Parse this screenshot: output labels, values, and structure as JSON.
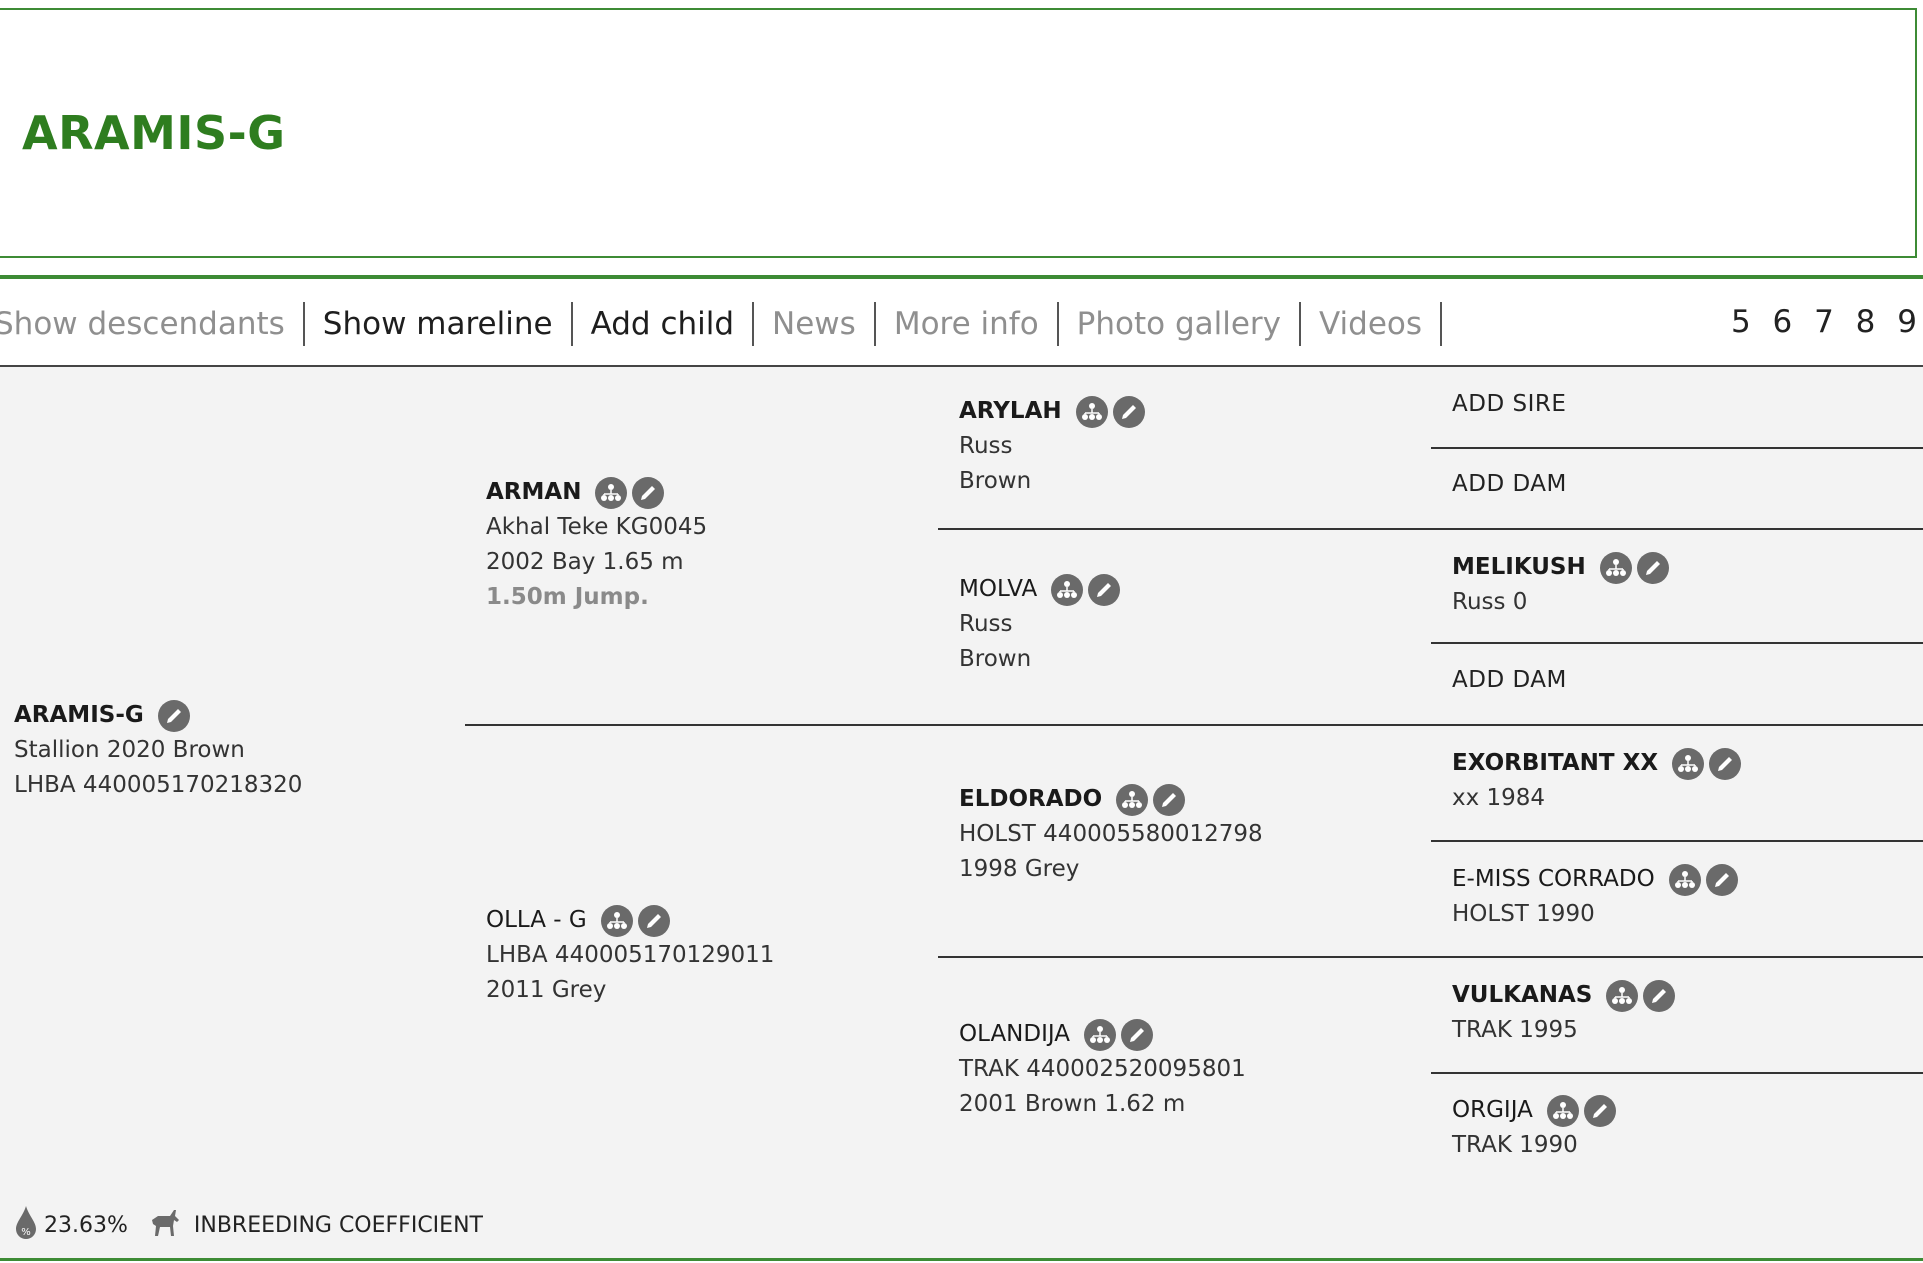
{
  "header": {
    "title": "ARAMIS-G"
  },
  "tabs": [
    {
      "label": "Show descendants",
      "state": "muted"
    },
    {
      "label": "Show mareline",
      "state": "active"
    },
    {
      "label": "Add child",
      "state": "active"
    },
    {
      "label": "News",
      "state": "muted"
    },
    {
      "label": "More info",
      "state": "muted"
    },
    {
      "label": "Photo gallery",
      "state": "muted"
    },
    {
      "label": "Videos",
      "state": "muted"
    }
  ],
  "generations_label": "5 6 7 8 9",
  "pedigree": {
    "subject": {
      "name": "ARAMIS-G",
      "line1": "Stallion 2020 Brown",
      "line2": "LHBA 440005170218320"
    },
    "sire": {
      "name": "ARMAN",
      "line1": "Akhal Teke KG0045",
      "line2": "2002 Bay 1.65 m",
      "line3": "1.50m Jump."
    },
    "dam": {
      "name": "OLLA - G",
      "line1": "LHBA 440005170129011",
      "line2": "2011 Grey"
    },
    "sire_sire": {
      "name": "ARYLAH",
      "line1": "Russ",
      "line2": "Brown"
    },
    "sire_dam": {
      "name": "MOLVA",
      "line1": "Russ",
      "line2": "Brown"
    },
    "dam_sire": {
      "name": "ELDORADO",
      "line1": "HOLST 440005580012798",
      "line2": "1998 Grey"
    },
    "dam_dam": {
      "name": "OLANDIJA",
      "line1": "TRAK 440002520095801",
      "line2": "2001 Brown 1.62 m"
    },
    "gen3": {
      "add_sire": "ADD SIRE",
      "add_dam_1": "ADD DAM",
      "melikush": {
        "name": "MELIKUSH",
        "line1": "Russ 0"
      },
      "add_dam_2": "ADD DAM",
      "exorbitant": {
        "name": "EXORBITANT XX",
        "line1": "xx 1984"
      },
      "emiss": {
        "name": "E-MISS CORRADO",
        "line1": "HOLST 1990"
      },
      "vulkanas": {
        "name": "VULKANAS",
        "line1": "TRAK 1995"
      },
      "orgija": {
        "name": "ORGIJA",
        "line1": "TRAK 1990"
      }
    }
  },
  "footer": {
    "inbreeding_value": "23.63%",
    "inbreeding_label": "INBREEDING COEFFICIENT"
  }
}
